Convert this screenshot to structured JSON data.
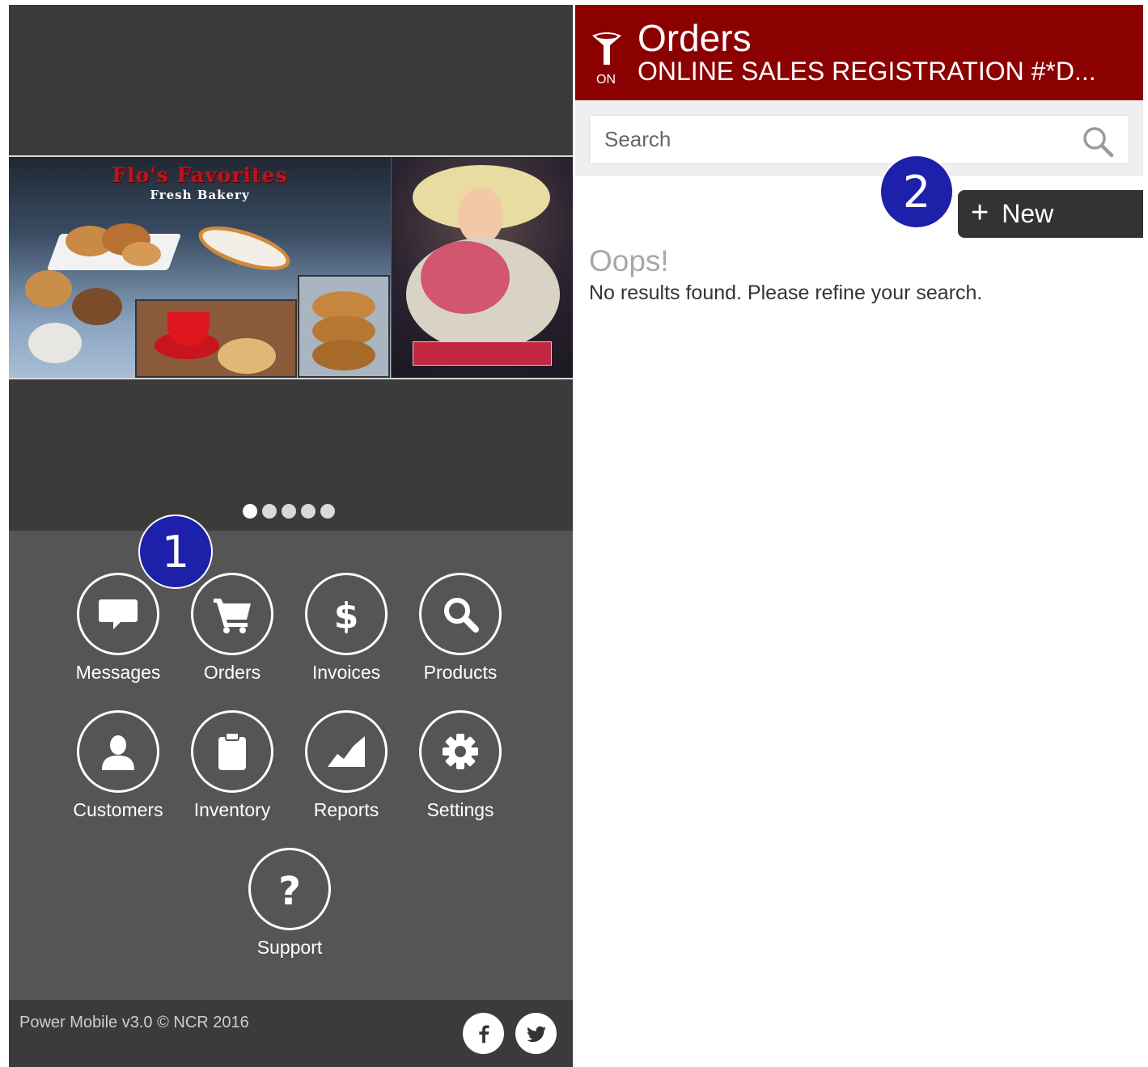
{
  "home": {
    "banner": {
      "bakery_title": "Flo's Favorites",
      "bakery_subtitle": "Fresh Bakery",
      "carousel_pages": 5,
      "carousel_active_index": 0
    },
    "menu": [
      {
        "id": "messages",
        "label": "Messages",
        "icon": "message-icon"
      },
      {
        "id": "orders",
        "label": "Orders",
        "icon": "cart-icon"
      },
      {
        "id": "invoices",
        "label": "Invoices",
        "icon": "dollar-icon"
      },
      {
        "id": "products",
        "label": "Products",
        "icon": "search-icon"
      },
      {
        "id": "customers",
        "label": "Customers",
        "icon": "person-icon"
      },
      {
        "id": "inventory",
        "label": "Inventory",
        "icon": "clipboard-icon"
      },
      {
        "id": "reports",
        "label": "Reports",
        "icon": "chart-icon"
      },
      {
        "id": "settings",
        "label": "Settings",
        "icon": "gear-icon"
      },
      {
        "id": "support",
        "label": "Support",
        "icon": "question-icon"
      }
    ],
    "footer": {
      "text": "Power Mobile v3.0 © NCR 2016",
      "social": [
        "facebook-icon",
        "twitter-icon"
      ]
    }
  },
  "annotations": {
    "step1": "1",
    "step2": "2"
  },
  "orders_screen": {
    "title": "Orders",
    "subtitle": "ONLINE SALES REGISTRATION #*D...",
    "filter_state": "ON",
    "search": {
      "placeholder": "Search",
      "value": ""
    },
    "new_button": {
      "plus": "+",
      "label": "New"
    },
    "empty_title": "Oops!",
    "empty_message": "No results found. Please refine your search."
  },
  "colors": {
    "header_red": "#8b0000",
    "menu_gray": "#555555",
    "dark_gray": "#3b3b3b",
    "badge_blue": "#1d20a8"
  }
}
